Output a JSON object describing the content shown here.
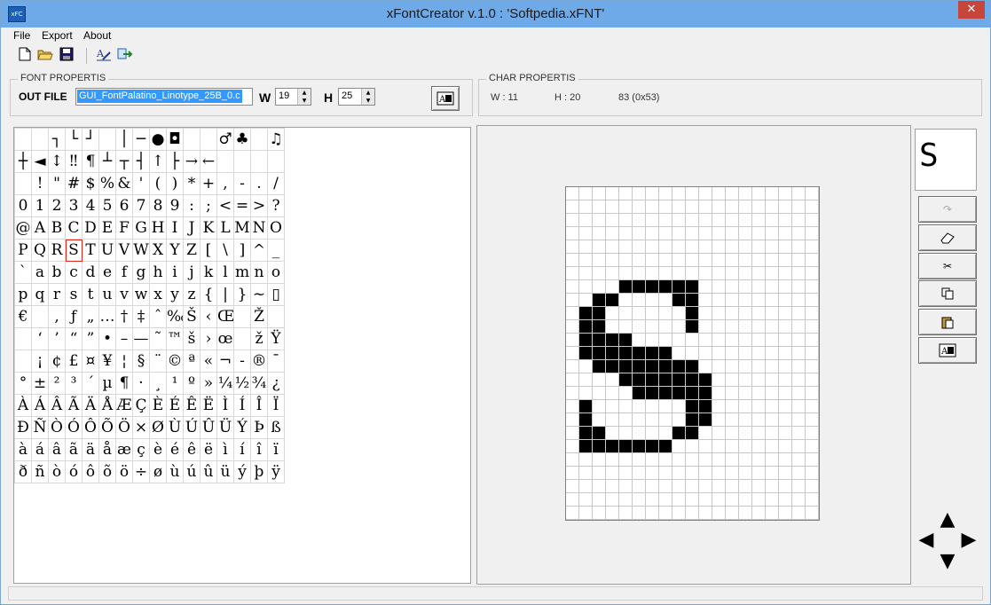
{
  "window": {
    "title": "xFontCreator v.1.0 : 'Softpedia.xFNT'",
    "app_icon_text": "xFC",
    "close_glyph": "✕"
  },
  "menu": {
    "items": [
      "File",
      "Export",
      "About"
    ]
  },
  "toolbar": {
    "icons": [
      "new-file-icon",
      "open-folder-icon",
      "save-disk-icon",
      "font-edit-icon",
      "export-icon"
    ]
  },
  "font_props": {
    "group_label": "FONT PROPERTIS",
    "out_file_label": "OUT FILE",
    "out_file_value": "GUI_FontPalatino_Linotype_25B_0.c",
    "w_label": "W",
    "w_value": "19",
    "h_label": "H",
    "h_value": "25"
  },
  "char_props": {
    "group_label": "CHAR PROPERTIS",
    "width": "W : 11",
    "height": "H : 20",
    "code": "83 (0x53)"
  },
  "char_table": {
    "selected": "S",
    "rows": [
      [
        "",
        "",
        "┐",
        "└",
        "┘",
        "",
        "│",
        "─",
        "●",
        "◘",
        "",
        "",
        "♂",
        "♣",
        "",
        "♫",
        "☼"
      ],
      [
        "┼",
        "◄",
        "↕",
        "‼",
        "¶",
        "┴",
        "┬",
        "┤",
        "↑",
        "├",
        "→",
        "←",
        "",
        "",
        "",
        ""
      ],
      [
        "",
        "!",
        "\"",
        "#",
        "$",
        "%",
        "&",
        "'",
        "(",
        ")",
        "*",
        "+",
        ",",
        "-",
        ".",
        "/"
      ],
      [
        "0",
        "1",
        "2",
        "3",
        "4",
        "5",
        "6",
        "7",
        "8",
        "9",
        ":",
        ";",
        "<",
        "=",
        ">",
        "?"
      ],
      [
        "@",
        "A",
        "B",
        "C",
        "D",
        "E",
        "F",
        "G",
        "H",
        "I",
        "J",
        "K",
        "L",
        "M",
        "N",
        "O"
      ],
      [
        "P",
        "Q",
        "R",
        "S",
        "T",
        "U",
        "V",
        "W",
        "X",
        "Y",
        "Z",
        "[",
        "\\",
        "]",
        "^",
        "_"
      ],
      [
        "`",
        "a",
        "b",
        "c",
        "d",
        "e",
        "f",
        "g",
        "h",
        "i",
        "j",
        "k",
        "l",
        "m",
        "n",
        "o"
      ],
      [
        "p",
        "q",
        "r",
        "s",
        "t",
        "u",
        "v",
        "w",
        "x",
        "y",
        "z",
        "{",
        "|",
        "}",
        "~",
        "▯"
      ],
      [
        "€",
        "",
        "‚",
        "ƒ",
        "„",
        "…",
        "†",
        "‡",
        "ˆ",
        "‰",
        "Š",
        "‹",
        "Œ",
        "",
        "Ž",
        ""
      ],
      [
        "",
        "‘",
        "’",
        "“",
        "”",
        "•",
        "–",
        "—",
        "˜",
        "™",
        "š",
        "›",
        "œ",
        "",
        "ž",
        "Ÿ"
      ],
      [
        "",
        "¡",
        "¢",
        "£",
        "¤",
        "¥",
        "¦",
        "§",
        "¨",
        "©",
        "ª",
        "«",
        "¬",
        "-",
        "®",
        "¯"
      ],
      [
        "°",
        "±",
        "²",
        "³",
        "´",
        "µ",
        "¶",
        "·",
        "¸",
        "¹",
        "º",
        "»",
        "¼",
        "½",
        "¾",
        "¿"
      ],
      [
        "À",
        "Á",
        "Â",
        "Ã",
        "Ä",
        "Å",
        "Æ",
        "Ç",
        "È",
        "É",
        "Ê",
        "Ë",
        "Ì",
        "Í",
        "Î",
        "Ï"
      ],
      [
        "Ð",
        "Ñ",
        "Ò",
        "Ó",
        "Ô",
        "Õ",
        "Ö",
        "×",
        "Ø",
        "Ù",
        "Ú",
        "Û",
        "Ü",
        "Ý",
        "Þ",
        "ß"
      ],
      [
        "à",
        "á",
        "â",
        "ã",
        "ä",
        "å",
        "æ",
        "ç",
        "è",
        "é",
        "ê",
        "ë",
        "ì",
        "í",
        "î",
        "ï"
      ],
      [
        "ð",
        "ñ",
        "ò",
        "ó",
        "ô",
        "õ",
        "ö",
        "÷",
        "ø",
        "ù",
        "ú",
        "û",
        "ü",
        "ý",
        "þ",
        "ÿ"
      ]
    ]
  },
  "glyph_editor": {
    "cols": 19,
    "rows": 25,
    "bitmap": [
      "",
      "",
      "",
      "",
      "",
      "",
      "",
      "4-9",
      "2-3,8-9",
      "1-2,9",
      "1-2,9",
      "1-4",
      "1-7",
      "2-9",
      "4-10",
      "5-10",
      "1,9-10",
      "1,9-10",
      "1-2,8-9",
      "1-7",
      "",
      "",
      "",
      "",
      ""
    ]
  },
  "preview": {
    "glyph": "S"
  },
  "side_tools": [
    "redo-icon",
    "eraser-icon",
    "cut-icon",
    "copy-icon",
    "paste-icon",
    "font-import-icon"
  ],
  "nav_arrows": {
    "up": "▲",
    "left": "◀",
    "right": "▶",
    "down": "▼"
  }
}
